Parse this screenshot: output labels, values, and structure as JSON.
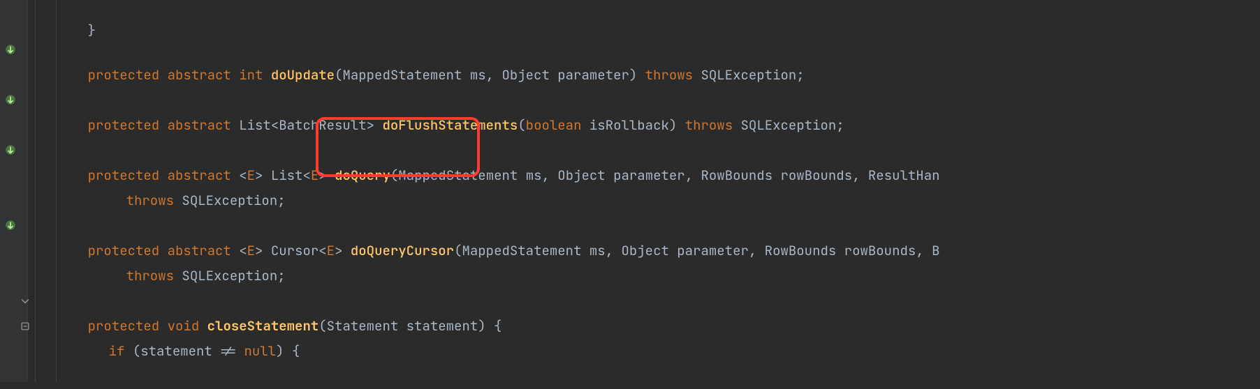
{
  "colors": {
    "keyword": "#cc7832",
    "method": "#ffc66d",
    "default": "#a9b7c6",
    "background": "#2b2b2b",
    "gutter": "#313335",
    "highlight": "#ff3b30"
  },
  "code": {
    "line1": {
      "brace": "}"
    },
    "line3": {
      "kw_protected": "protected",
      "kw_abstract": "abstract",
      "kw_int": "int",
      "method": "doUpdate",
      "params": "(MappedStatement ms, Object parameter)",
      "kw_throws": "throws",
      "exc": "SQLException;"
    },
    "line5": {
      "kw_protected": "protected",
      "kw_abstract": "abstract",
      "ret": "List<BatchResult>",
      "method": "doFlushStatements",
      "lparen": "(",
      "kw_bool": "boolean",
      "param_rest": " isRollback)",
      "kw_throws": "throws",
      "exc": "SQLException;"
    },
    "line7": {
      "kw_protected": "protected",
      "kw_abstract": "abstract",
      "generic_open": "<",
      "generic_E1": "E",
      "generic_mid": "> List<",
      "generic_E2": "E",
      "generic_close": ">",
      "method": "doQuery",
      "params": "(MappedStatement ms, Object parameter, RowBounds rowBounds, ResultHan"
    },
    "line8": {
      "kw_throws": "throws",
      "exc": "SQLException;"
    },
    "line10": {
      "kw_protected": "protected",
      "kw_abstract": "abstract",
      "generic_open": "<",
      "generic_E1": "E",
      "generic_mid": "> Cursor<",
      "generic_E2": "E",
      "generic_close": ">",
      "method": "doQueryCursor",
      "params": "(MappedStatement ms, Object parameter, RowBounds rowBounds, B"
    },
    "line11": {
      "kw_throws": "throws",
      "exc": "SQLException;"
    },
    "line13": {
      "kw_protected": "protected",
      "kw_void": "void",
      "method": "closeStatement",
      "params": "(Statement statement) {"
    },
    "line14": {
      "kw_if": "if",
      "rest": " (statement != ",
      "kw_null": "null",
      "brace": ") {"
    }
  },
  "gutter_icons": {
    "override": "override"
  }
}
